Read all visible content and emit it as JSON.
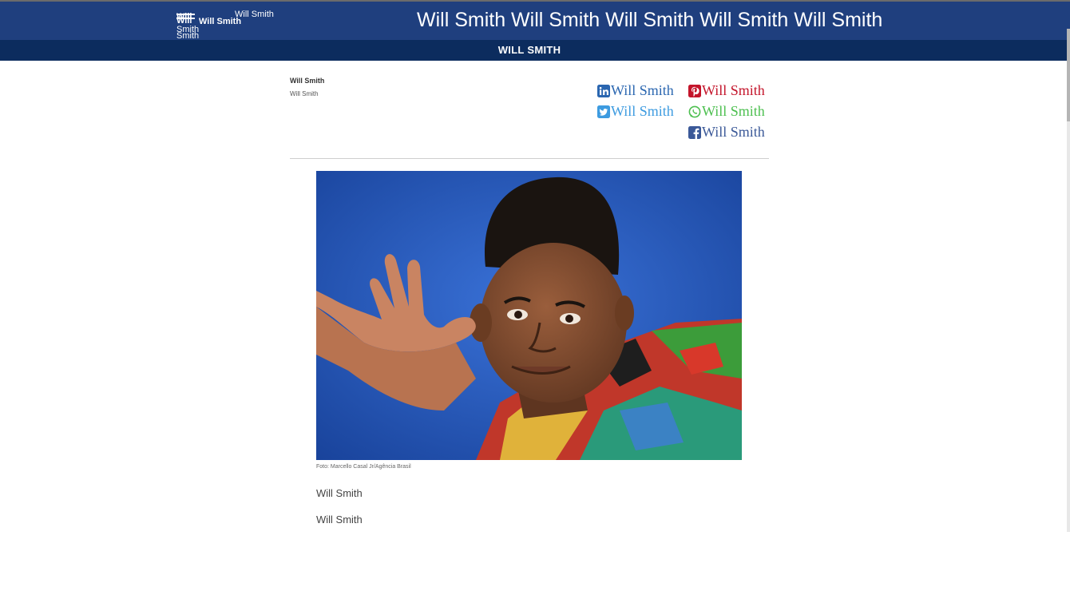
{
  "header": {
    "logo_stack": [
      "Will",
      "Will",
      "Smith",
      "Smith"
    ],
    "logo_name": "Will Smith",
    "logo_tagline": "Will Smith",
    "site_title": "Will Smith Will Smith Will Smith Will Smith Will Smith",
    "section_title": "WILL SMITH"
  },
  "article": {
    "author": "Will Smith",
    "date": "Will Smith",
    "image_caption": "Foto: Marcello Casal Jr/Agência Brasil",
    "paragraphs": [
      "Will Smith",
      "Will Smith"
    ]
  },
  "share": [
    {
      "network": "linkedin",
      "icon": "linkedin-icon",
      "label": "Will Smith",
      "color": "#2a66b0"
    },
    {
      "network": "pinterest",
      "icon": "pinterest-icon",
      "label": "Will Smith",
      "color": "#c4152b"
    },
    {
      "network": "twitter",
      "icon": "twitter-icon",
      "label": "Will Smith",
      "color": "#3d9be0"
    },
    {
      "network": "whatsapp",
      "icon": "whatsapp-icon",
      "label": "Will Smith",
      "color": "#4cbf4f"
    },
    {
      "network": "facebook",
      "icon": "facebook-icon",
      "label": "Will Smith",
      "color": "#3b5998"
    }
  ],
  "colors": {
    "header_bg": "#1f3f7e",
    "subheader_bg": "#0c2c5e"
  }
}
